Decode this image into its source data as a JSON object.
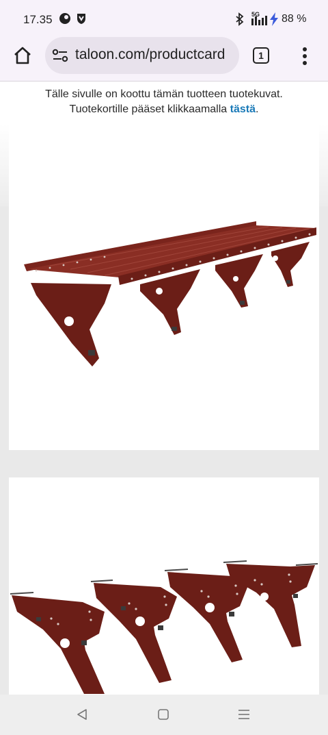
{
  "status_bar": {
    "time": "17.35",
    "network": "5G",
    "battery": "88 %"
  },
  "browser": {
    "url": "taloon.com/productcard",
    "tab_count": "1"
  },
  "notice": {
    "line1": "Tälle sivulle on koottu tämän tuotteen tuotekuvat.",
    "line2_text": "Tuotekortille pääset klikkaamalla",
    "link_text": "tästä",
    "period": "."
  },
  "colors": {
    "product": "#6b1e17",
    "link": "#1a7ab8"
  },
  "icons": {
    "home": "home-icon",
    "tune": "tune-icon",
    "tabs": "tab-switcher-icon",
    "menu": "more-vert-icon",
    "back": "back-triangle-icon",
    "recent": "recent-square-icon",
    "app_menu": "menu-lines-icon"
  }
}
